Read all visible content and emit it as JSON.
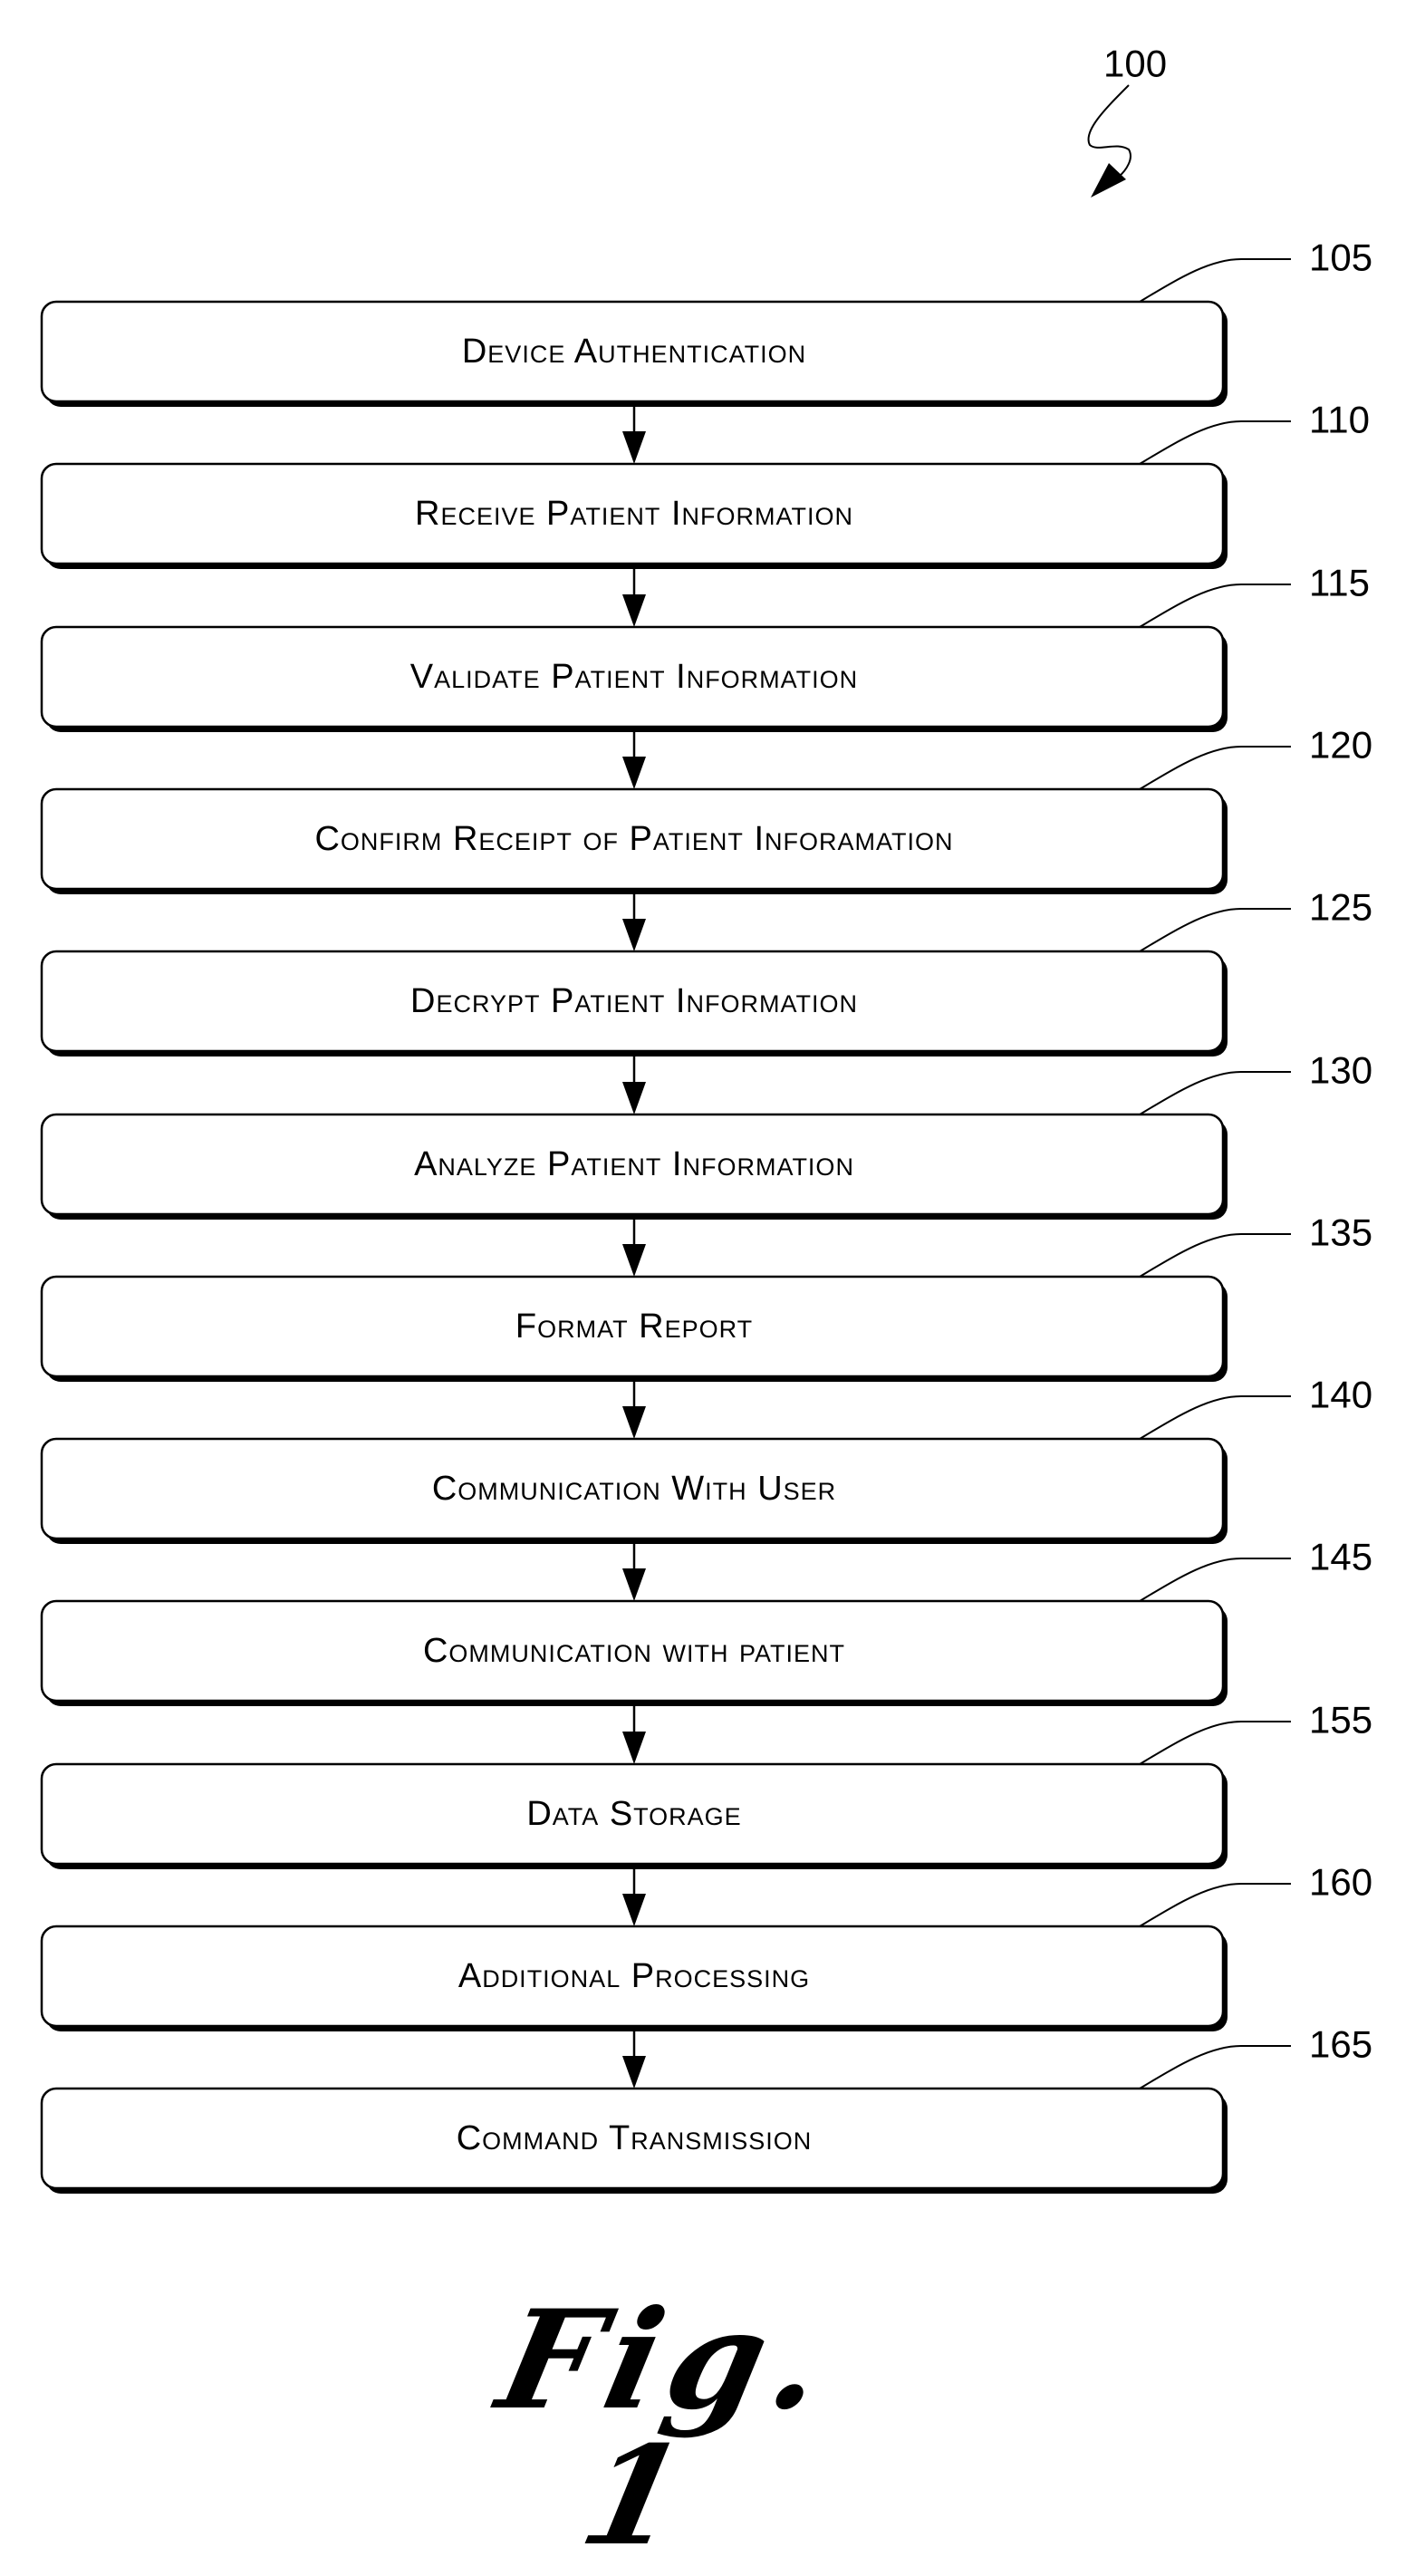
{
  "figure": {
    "reference_number": "100",
    "caption": "Fig. 1"
  },
  "steps": [
    {
      "ref": "105",
      "label": "Device Authentication"
    },
    {
      "ref": "110",
      "label": "Receive Patient Information"
    },
    {
      "ref": "115",
      "label": "Validate Patient Information"
    },
    {
      "ref": "120",
      "label": "Confirm Receipt of Patient Inforamation"
    },
    {
      "ref": "125",
      "label": "Decrypt Patient Information"
    },
    {
      "ref": "130",
      "label": "Analyze Patient Information"
    },
    {
      "ref": "135",
      "label": "Format Report"
    },
    {
      "ref": "140",
      "label": "Communication With User"
    },
    {
      "ref": "145",
      "label": "Communication with patient"
    },
    {
      "ref": "155",
      "label": "Data Storage"
    },
    {
      "ref": "160",
      "label": "Additional Processing"
    },
    {
      "ref": "165",
      "label": "Command Transmission"
    }
  ]
}
